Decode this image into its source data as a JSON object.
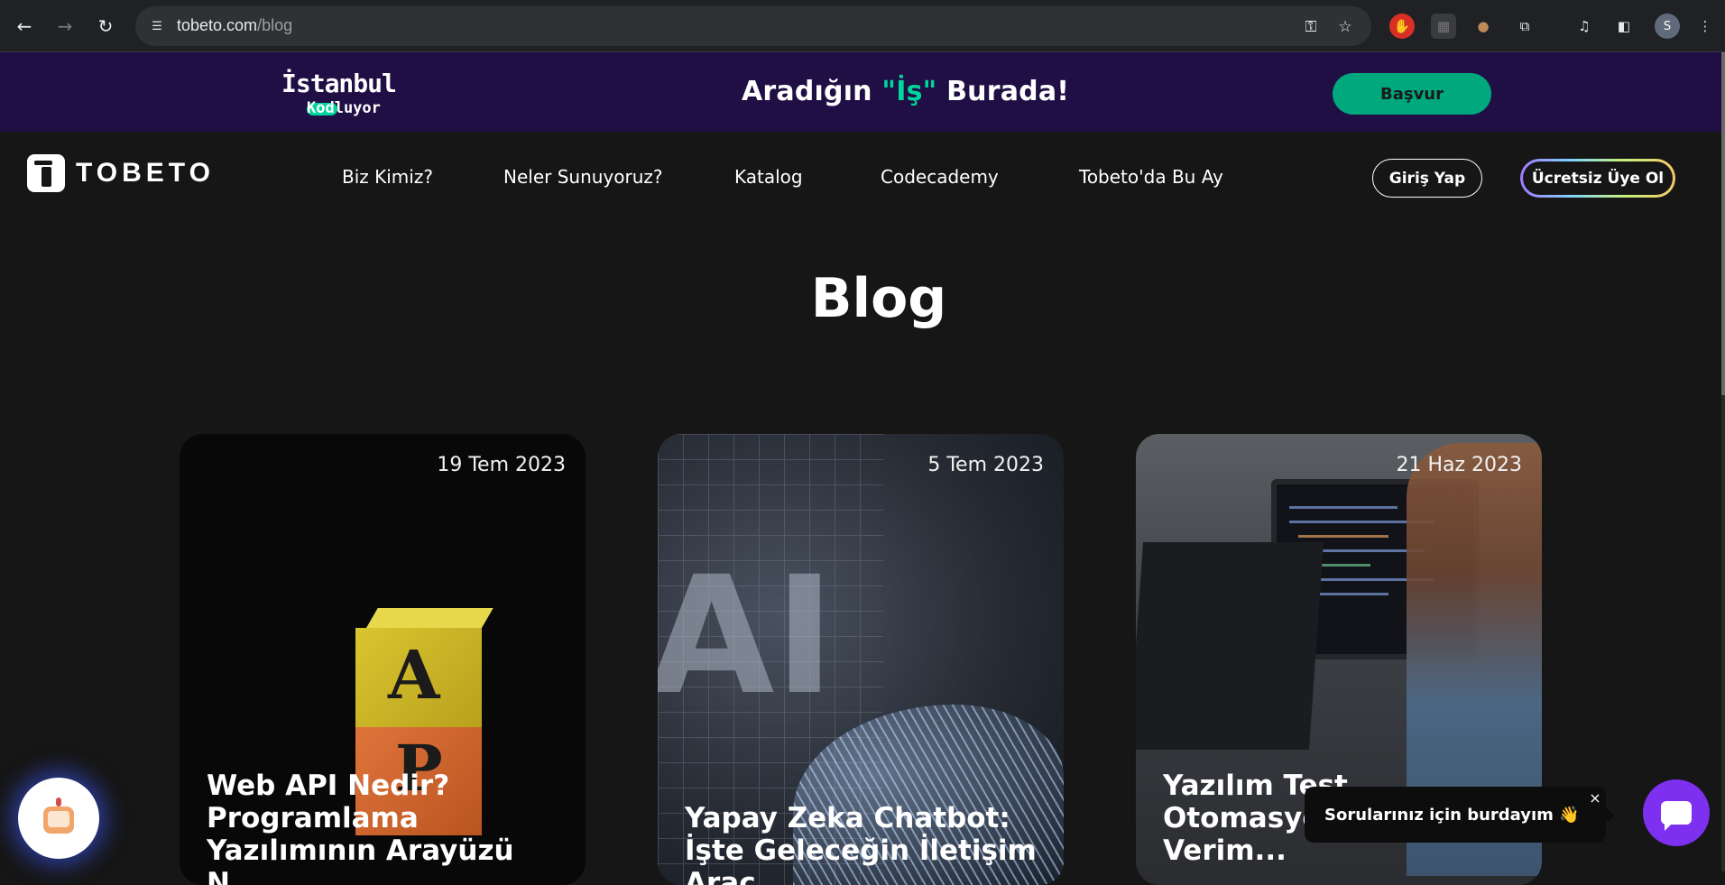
{
  "browser": {
    "url_host": "tobeto.com",
    "url_path": "/blog",
    "icons": [
      "back-arrow-icon",
      "forward-arrow-icon",
      "reload-icon",
      "site-settings-icon",
      "password-key-icon",
      "bookmark-star-icon",
      "extension-icon",
      "puzzle-extensions-icon",
      "media-control-icon",
      "side-panel-icon",
      "profile-avatar-icon",
      "more-menu-icon"
    ]
  },
  "promo": {
    "logo_line1": "İstanbul",
    "logo_line2": "Kodluyor",
    "headline_pre": "Aradığın ",
    "headline_quote": "\"İş\"",
    "headline_post": " Burada!",
    "cta": "Başvur"
  },
  "header": {
    "logo_text": "TOBETO",
    "nav": [
      "Biz Kimiz?",
      "Neler Sunuyoruz?",
      "Katalog",
      "Codecademy",
      "Tobeto'da Bu Ay"
    ],
    "login": "Giriş Yap",
    "signup": "Ücretsiz Üye Ol"
  },
  "page": {
    "title": "Blog"
  },
  "posts": [
    {
      "date": "19 Tem 2023",
      "title": "Web API Nedir? Programlama Yazılımının Arayüzü N..."
    },
    {
      "date": "5 Tem 2023",
      "title": "Yapay Zeka Chatbot: İşte Geleceğin İletişim Arac..."
    },
    {
      "date": "21 Haz 2023",
      "title": "Yazılım Test Otomasyo... Daha Verim..."
    }
  ],
  "card_art": {
    "block_letter_1": "A",
    "block_letter_2": "P",
    "ai_letters": "AI"
  },
  "chat": {
    "tooltip": "Sorularınız için burdayım 👋",
    "close": "×"
  }
}
